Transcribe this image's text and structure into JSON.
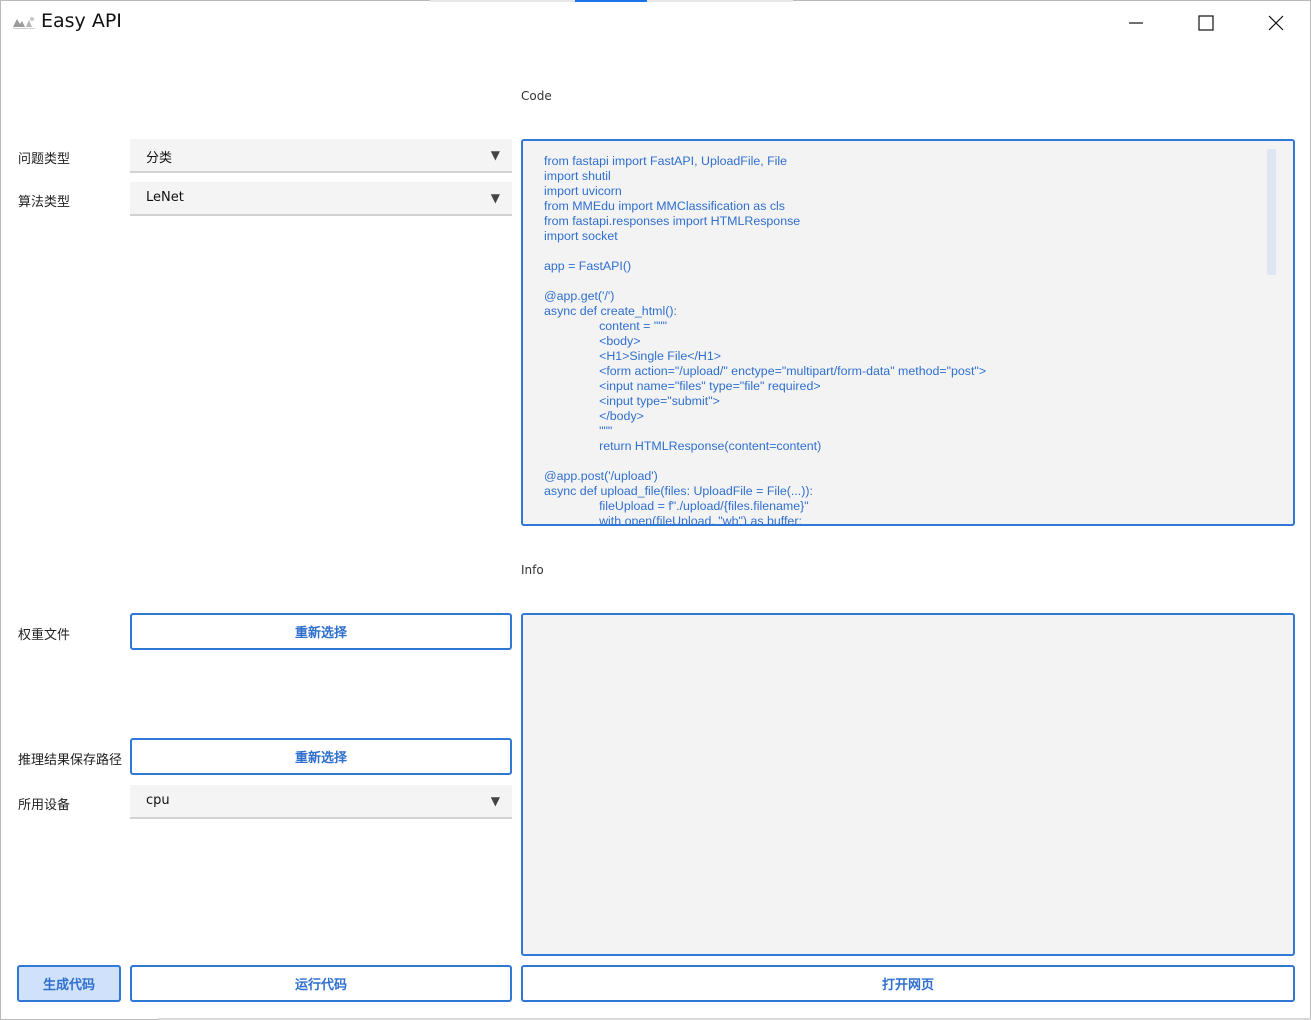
{
  "window": {
    "title": "Easy API",
    "app_icon": "easy-api-logo",
    "controls": {
      "minimize_icon": "minimize-icon",
      "maximize_icon": "maximize-icon",
      "close_icon": "close-icon"
    }
  },
  "colors": {
    "accent": "#2f78d6",
    "accent_text": "#2f6fce",
    "field_bg": "#f4f4f4",
    "active_btn_bg": "#cfe1fb"
  },
  "form": {
    "problem_type": {
      "label": "问题类型",
      "value": "分类"
    },
    "algorithm_type": {
      "label": "算法类型",
      "value": "LeNet"
    },
    "weights_file": {
      "label": "权重文件",
      "button": "重新选择"
    },
    "result_path": {
      "label": "推理结果保存路径",
      "button": "重新选择"
    },
    "device": {
      "label": "所用设备",
      "value": "cpu"
    }
  },
  "dropdown_arrow": "▼",
  "code": {
    "label": "Code",
    "content": "from fastapi import FastAPI, UploadFile, File\nimport shutil\nimport uvicorn\nfrom MMEdu import MMClassification as cls\nfrom fastapi.responses import HTMLResponse\nimport socket\n\napp = FastAPI()\n\n@app.get('/')\nasync def create_html():\n\t\tcontent = \"\"\"\n\t\t<body>\n\t\t<H1>Single File</H1>\n\t\t<form action=\"/upload/\" enctype=\"multipart/form-data\" method=\"post\">\n\t\t<input name=\"files\" type=\"file\" required>\n\t\t<input type=\"submit\">\n\t\t</body>\n\t\t\"\"\"\n\t\treturn HTMLResponse(content=content)\n\n@app.post('/upload')\nasync def upload_file(files: UploadFile = File(...)):\n\t\tfileUpload = f\"./upload/{files.filename}\"\n\t\twith open(fileUpload, \"wb\") as buffer:"
  },
  "info": {
    "label": "Info",
    "content": ""
  },
  "actions": {
    "generate_code": "生成代码",
    "run_code": "运行代码",
    "open_webpage": "打开网页"
  }
}
